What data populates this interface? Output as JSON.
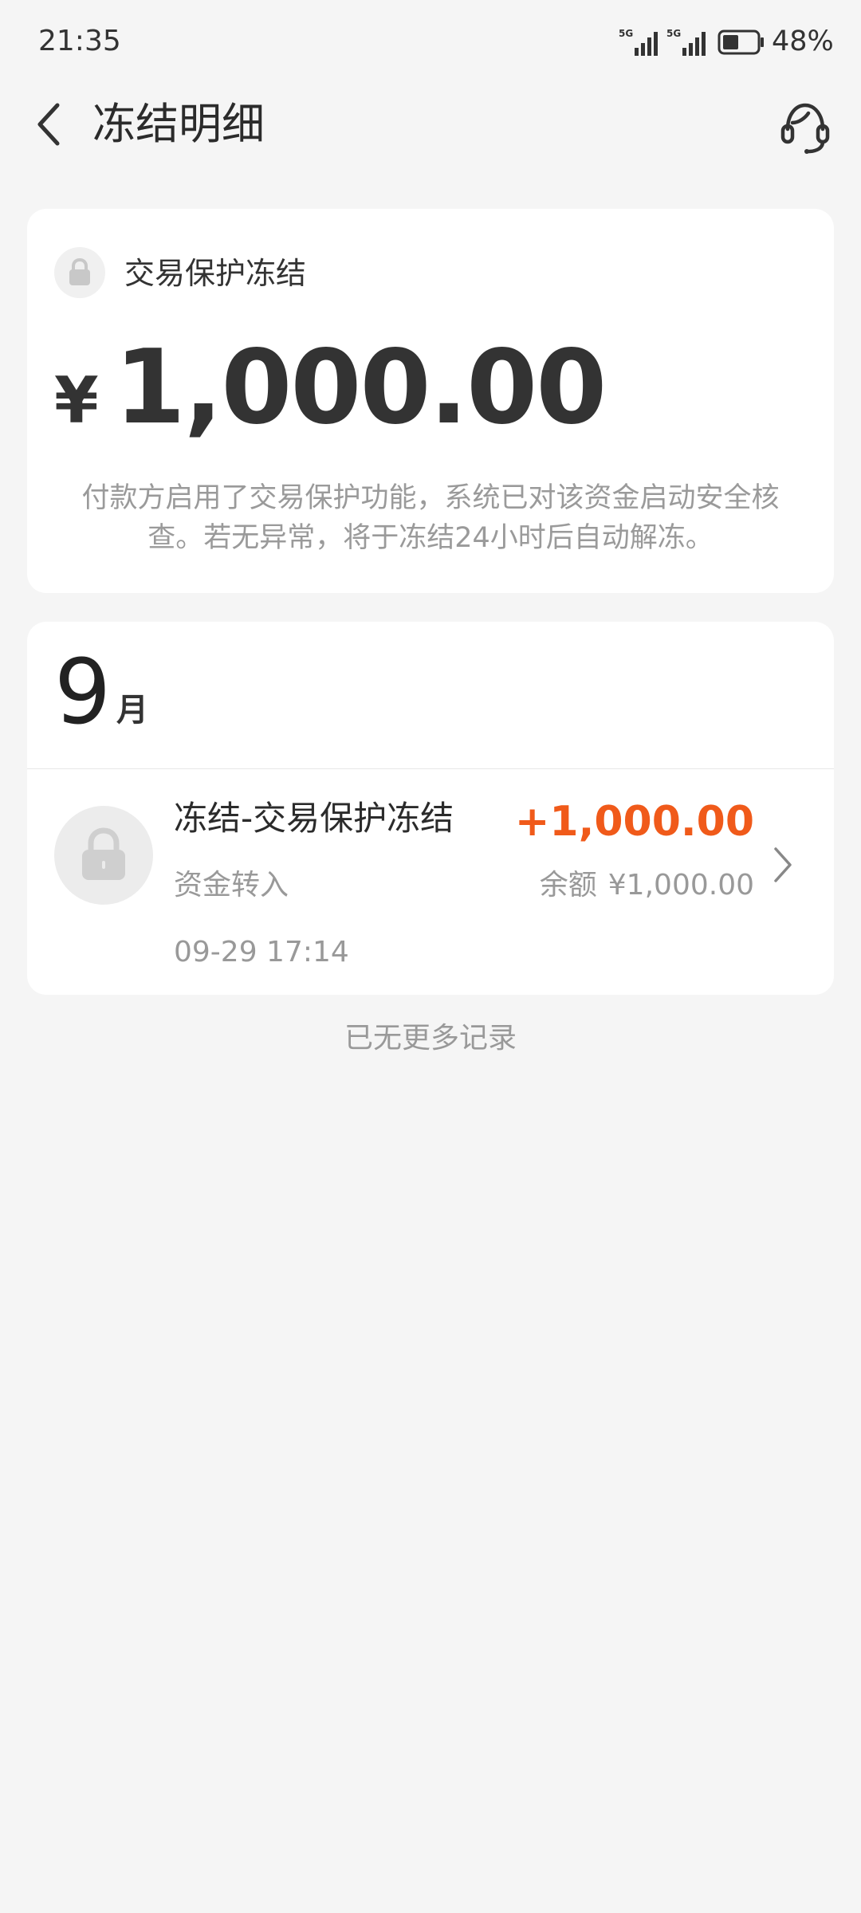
{
  "status_bar": {
    "time": "21:35",
    "battery_percent": "48%",
    "battery_level": 0.48,
    "signal_icons": [
      "5g-signal-icon",
      "5g-signal-icon"
    ]
  },
  "header": {
    "title": "冻结明细",
    "back_icon": "chevron-left-icon",
    "service_icon": "customer-service-headset-icon"
  },
  "freeze_summary": {
    "type_label": "交易保护冻结",
    "type_icon": "lock-icon",
    "currency_symbol": "¥",
    "amount": "1,000.00",
    "description": "付款方启用了交易保护功能，系统已对该资金启动安全核查。若无异常，将于冻结24小时后自动解冻。"
  },
  "records": {
    "month_number": "9",
    "month_unit": "月",
    "items": [
      {
        "icon": "lock-icon",
        "title": "冻结-交易保护冻结",
        "subtitle": "资金转入",
        "time": "09-29 17:14",
        "amount": "+1,000.00",
        "balance_label": "余额",
        "balance_value": "¥1,000.00"
      }
    ],
    "footer_text": "已无更多记录"
  },
  "colors": {
    "background": "#f5f5f5",
    "card": "#ffffff",
    "accent_amount": "#f05a1a",
    "secondary_text": "#999999"
  }
}
